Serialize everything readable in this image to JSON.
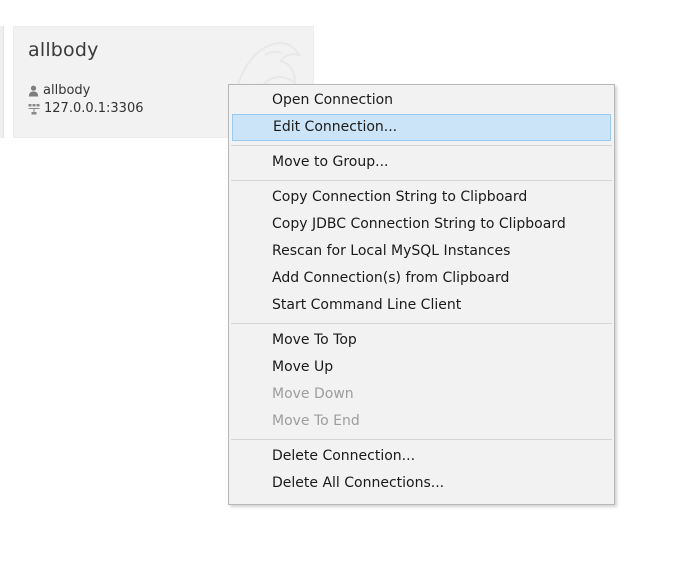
{
  "connection": {
    "name": "allbody",
    "user": "allbody",
    "host": "127.0.0.1:3306",
    "user_icon": "user-icon",
    "host_icon": "network-icon",
    "brand_icon": "dolphin-logo-icon"
  },
  "context_menu": {
    "groups": [
      [
        {
          "label": "Open Connection",
          "enabled": true,
          "highlighted": false
        },
        {
          "label": "Edit Connection...",
          "enabled": true,
          "highlighted": true
        }
      ],
      [
        {
          "label": "Move to Group...",
          "enabled": true,
          "highlighted": false
        }
      ],
      [
        {
          "label": "Copy Connection String to Clipboard",
          "enabled": true,
          "highlighted": false
        },
        {
          "label": "Copy JDBC Connection String to Clipboard",
          "enabled": true,
          "highlighted": false
        },
        {
          "label": "Rescan for Local MySQL Instances",
          "enabled": true,
          "highlighted": false
        },
        {
          "label": "Add Connection(s) from Clipboard",
          "enabled": true,
          "highlighted": false
        },
        {
          "label": "Start Command Line Client",
          "enabled": true,
          "highlighted": false
        }
      ],
      [
        {
          "label": "Move To Top",
          "enabled": true,
          "highlighted": false
        },
        {
          "label": "Move Up",
          "enabled": true,
          "highlighted": false
        },
        {
          "label": "Move Down",
          "enabled": false,
          "highlighted": false
        },
        {
          "label": "Move To End",
          "enabled": false,
          "highlighted": false
        }
      ],
      [
        {
          "label": "Delete Connection...",
          "enabled": true,
          "highlighted": false
        },
        {
          "label": "Delete All Connections...",
          "enabled": true,
          "highlighted": false
        }
      ]
    ]
  },
  "colors": {
    "highlight_bg": "#cce4f7",
    "highlight_border": "#99c9ef",
    "disabled_text": "#9d9d9d"
  }
}
